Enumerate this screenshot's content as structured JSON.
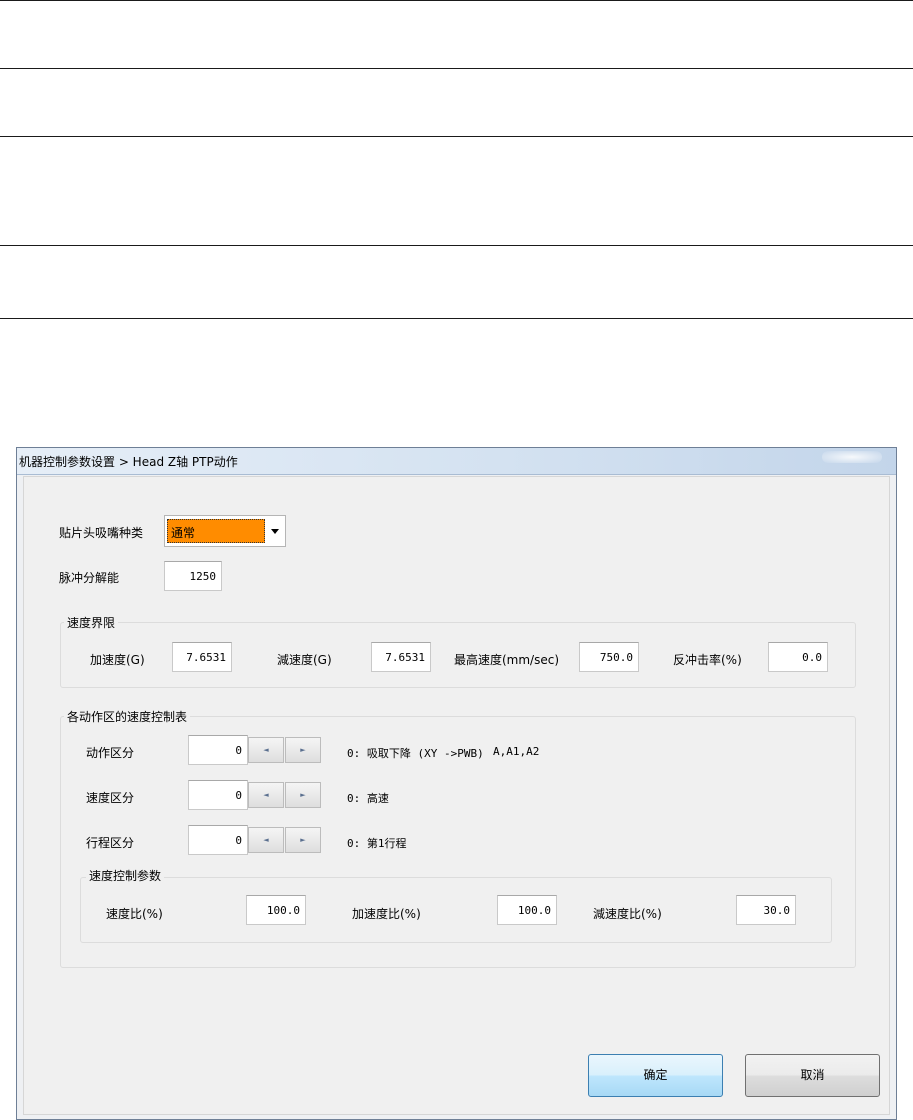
{
  "window": {
    "title": "机器控制参数设置 > Head Z轴 PTP动作"
  },
  "nozzle_type": {
    "label": "贴片头吸嘴种类",
    "value": "通常"
  },
  "pulse_resolution": {
    "label": "脉冲分解能",
    "value": "1250"
  },
  "speed_limits": {
    "group_title": "速度界限",
    "accel_label": "加速度(G)",
    "accel_value": "7.6531",
    "decel_label": "減速度(G)",
    "decel_value": "7.6531",
    "max_speed_label": "最高速度(mm/sec)",
    "max_speed_value": "750.0",
    "rebound_label": "反冲击率(%)",
    "rebound_value": "0.0"
  },
  "speed_table": {
    "group_title": "各动作区的速度控制表",
    "action": {
      "label": "动作区分",
      "value": "0",
      "desc": "0: 吸取下降 (XY ->PWB)",
      "desc_extra": "A,A1,A2"
    },
    "speed": {
      "label": "速度区分",
      "value": "0",
      "desc": "0: 高速"
    },
    "stroke": {
      "label": "行程区分",
      "value": "0",
      "desc": "0: 第1行程"
    },
    "params": {
      "group_title": "速度控制参数",
      "speed_ratio_label": "速度比(%)",
      "speed_ratio_value": "100.0",
      "accel_ratio_label": "加速度比(%)",
      "accel_ratio_value": "100.0",
      "decel_ratio_label": "減速度比(%)",
      "decel_ratio_value": "30.0"
    }
  },
  "spin_arrows": {
    "left": "◄",
    "right": "►"
  },
  "buttons": {
    "ok": "确定",
    "cancel": "取消"
  },
  "colors": {
    "combo_highlight": "#ff8c00",
    "ok_border": "#3c7fb1"
  }
}
